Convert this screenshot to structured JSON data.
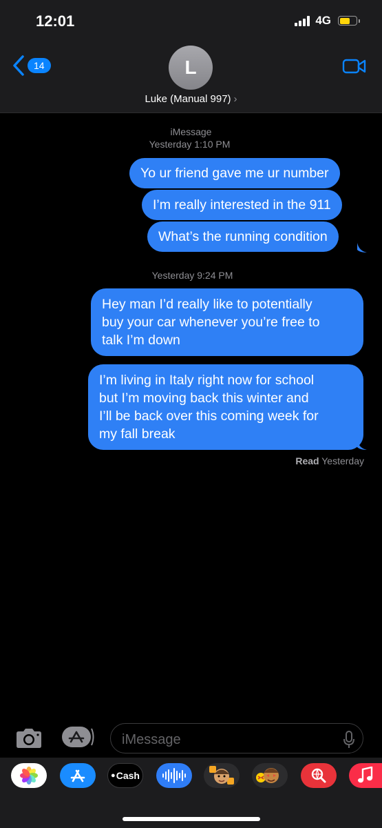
{
  "status_bar": {
    "time": "12:01",
    "network": "4G"
  },
  "header": {
    "back_badge": "14",
    "avatar_initial": "L",
    "contact_name": "Luke (Manual 997)",
    "chevron": "›"
  },
  "conversation": {
    "service_label": "iMessage",
    "timestamp_1": "Yesterday 1:10 PM",
    "messages_1": [
      "Yo ur friend gave me ur number",
      "I’m really interested in the 911",
      "What’s the running condition"
    ],
    "timestamp_2": "Yesterday 9:24 PM",
    "message_2_lines": [
      "Hey man I’d really like to potentially",
      "buy your car whenever you’re free to",
      "talk I’m down"
    ],
    "message_3_lines": [
      "I’m living in Italy right now for school",
      "but I’m moving back this winter and",
      "I’ll be back over this coming week for",
      "my fall break"
    ],
    "read_label": "Read",
    "read_time": "Yesterday"
  },
  "composer": {
    "placeholder": "iMessage"
  },
  "app_drawer": {
    "apps": [
      "photos-icon",
      "app-store-icon",
      "apple-cash-icon",
      "audio-message-icon",
      "memoji-icon",
      "animoji-icon",
      "web-search-icon",
      "music-icon"
    ],
    "cash_label": "Cash"
  },
  "colors": {
    "bubble": "#2f80f5",
    "accent": "#0a84ff",
    "background": "#000000",
    "header": "#1c1c1e"
  }
}
